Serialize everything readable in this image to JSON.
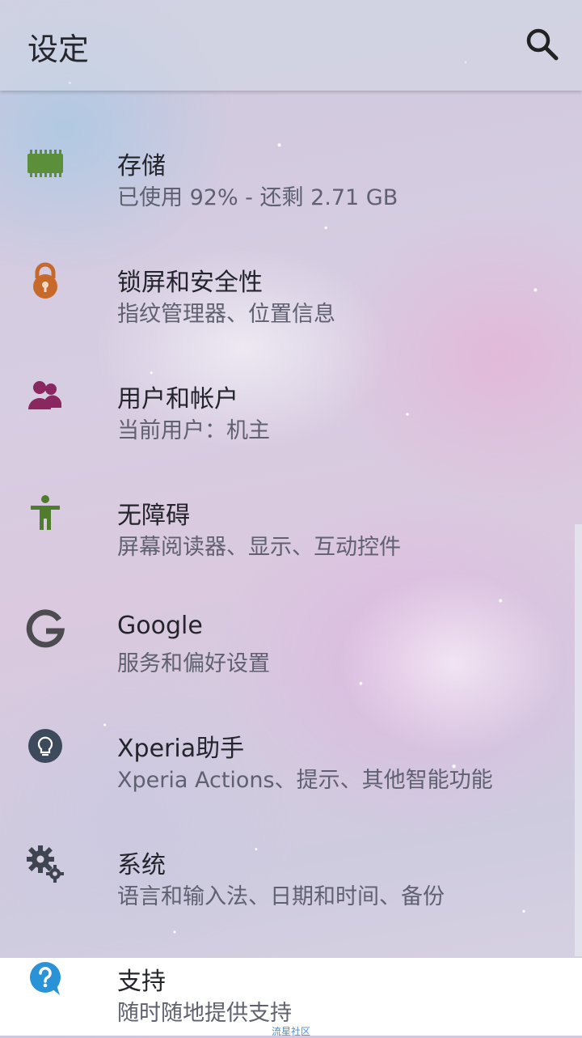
{
  "app_bar": {
    "title": "设定",
    "search_icon": "search-icon"
  },
  "settings": {
    "items": [
      {
        "icon": "memory-chip-icon",
        "title": "存储",
        "subtitle": "已使用 92% - 还剩 2.71 GB",
        "icon_color": "#5b8f3a"
      },
      {
        "icon": "lock-icon",
        "title": "锁屏和安全性",
        "subtitle": "指纹管理器、位置信息",
        "icon_color": "#c8692c"
      },
      {
        "icon": "users-icon",
        "title": "用户和帐户",
        "subtitle": "当前用户：机主",
        "icon_color": "#8a2660"
      },
      {
        "icon": "accessibility-icon",
        "title": "无障碍",
        "subtitle": "屏幕阅读器、显示、互动控件",
        "icon_color": "#4f7d2d"
      },
      {
        "icon": "google-g-icon",
        "title": "Google",
        "subtitle": "服务和偏好设置",
        "icon_color": "#4b4b50"
      },
      {
        "icon": "lightbulb-icon",
        "title": "Xperia助手",
        "subtitle": "Xperia Actions、提示、其他智能功能",
        "icon_color": "#3d4a5c"
      },
      {
        "icon": "gears-icon",
        "title": "系统",
        "subtitle": "语言和输入法、日期和时间、备份",
        "icon_color": "#3f4550"
      },
      {
        "icon": "help-bubble-icon",
        "title": "支持",
        "subtitle": "随时随地提供支持",
        "icon_color": "#2a93d8"
      }
    ]
  },
  "watermark": "流星社区"
}
